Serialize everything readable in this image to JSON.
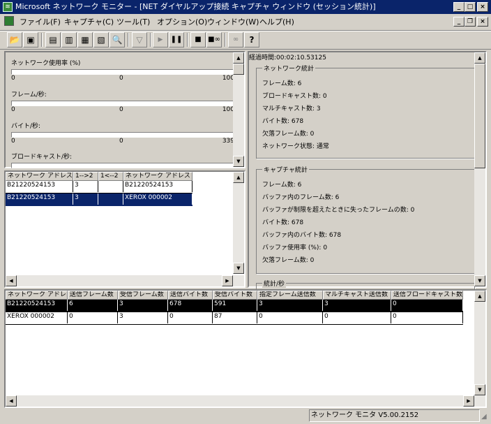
{
  "window": {
    "title": "Microsoft ネットワーク モニター - [NET ダイヤルアップ接続 キャプチャ ウィンドウ (セッション統計)]"
  },
  "menu": [
    "ファイル(F)",
    "キャプチャ(C)",
    "ツール(T)",
    "オプション(O)",
    "ウィンドウ(W)",
    "ヘルプ(H)"
  ],
  "toolbar": {
    "icons": [
      "open-icon",
      "save-icon",
      "pane1-icon",
      "pane2-icon",
      "pane3-icon",
      "pane4-icon",
      "find-icon",
      "filter-icon",
      "start-icon",
      "pause-icon",
      "stop-icon",
      "stop-view-icon",
      "view-icon",
      "help-icon"
    ],
    "help_label": "?"
  },
  "gauges": [
    {
      "label": "ネットワーク使用率 (%)",
      "min": "0",
      "mid": "0",
      "max": "100",
      "fill": 0
    },
    {
      "label": "フレーム/秒:",
      "min": "0",
      "mid": "0",
      "max": "100",
      "fill": 0
    },
    {
      "label": "バイト/秒:",
      "min": "0",
      "mid": "0",
      "max": "339",
      "fill": 0
    },
    {
      "label": "ブロードキャスト/秒:"
    }
  ],
  "session": {
    "headers": [
      "ネットワーク アドレス 1",
      "1-->2",
      "1<--2",
      "ネットワーク アドレス 2"
    ],
    "rows": [
      [
        "B21220524153",
        "3",
        "",
        "B21220524153"
      ],
      [
        "B21220524153",
        "3",
        "",
        "XEROX 000002"
      ]
    ]
  },
  "stats": {
    "elapsed": "経過時間:00:02:10.53125",
    "network_title": "ネットワーク統計",
    "network": [
      "フレーム数: 6",
      "ブロードキャスト数: 0",
      "マルチキャスト数: 3",
      "バイト数: 678",
      "欠落フレーム数: 0",
      "ネットワーク状態: 通常"
    ],
    "capture_title": "キャプチャ統計",
    "capture": [
      "フレーム数: 6",
      "バッファ内のフレーム数: 6",
      "バッファが制限を超えたときに失ったフレームの数: 0",
      "バイト数: 678",
      "バッファ内のバイト数: 678",
      "バッファ使用率 (%): 0",
      "欠落フレーム数: 0"
    ],
    "persec_title": "統計/秒"
  },
  "station": {
    "headers": [
      "ネットワーク アドレス",
      "送信フレーム数",
      "受信フレーム数",
      "送信バイト数",
      "受信バイト数",
      "指定フレーム送信数",
      "マルチキャスト送信数",
      "送信ブロードキャスト数"
    ],
    "rows": [
      [
        "B21220524153",
        "6",
        "3",
        "678",
        "591",
        "3",
        "3",
        "0"
      ],
      [
        "XEROX 000002",
        "0",
        "3",
        "0",
        "87",
        "0",
        "0",
        "0"
      ]
    ]
  },
  "statusbar": {
    "version": "ネットワーク モニタ V5.00.2152"
  }
}
